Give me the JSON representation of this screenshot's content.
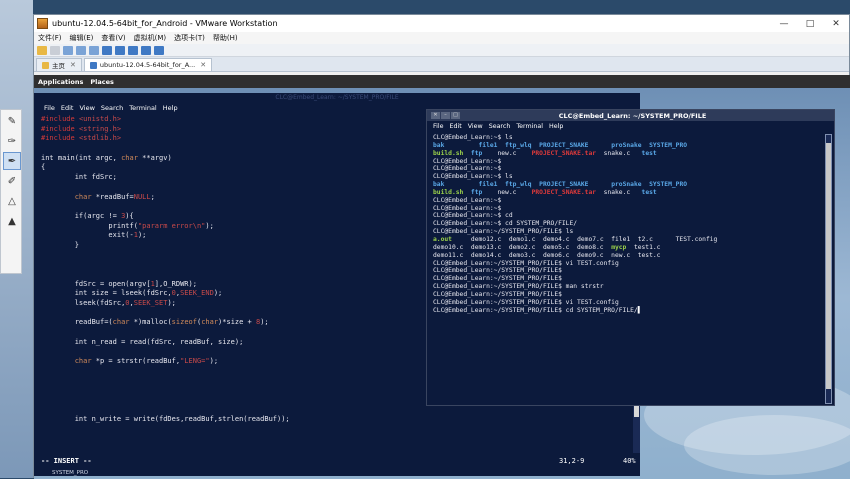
{
  "vm": {
    "title": "ubuntu-12.04.5-64bit_for_Android - VMware Workstation",
    "menu": [
      "文件(F)",
      "编辑(E)",
      "查看(V)",
      "虚拟机(M)",
      "选项卡(T)",
      "帮助(H)"
    ],
    "tabs": [
      {
        "label": "主页",
        "active": false
      },
      {
        "label": "ubuntu-12.04.5-64bit_for_A...",
        "active": true
      }
    ],
    "window_controls": [
      "—",
      "□",
      "✕"
    ]
  },
  "guest": {
    "panel": [
      "Applications",
      "Places"
    ],
    "editor": {
      "title": "CLC@Embed_Learn: ~/SYSTEM_PRO/FILE",
      "menu": [
        "File",
        "Edit",
        "View",
        "Search",
        "Terminal",
        "Help"
      ],
      "lines": [
        [
          [
            "pp",
            "#include "
          ],
          [
            "str",
            "<unistd.h>"
          ]
        ],
        [
          [
            "pp",
            "#include "
          ],
          [
            "str",
            "<string.h>"
          ]
        ],
        [
          [
            "pp",
            "#include "
          ],
          [
            "str",
            "<stdlib.h>"
          ]
        ],
        [],
        [
          [
            "kw",
            "int main(int argc, "
          ],
          [
            "typ",
            "char"
          ],
          [
            "kw",
            " **argv)"
          ]
        ],
        [
          [
            "kw",
            "{"
          ]
        ],
        [
          [
            "kw",
            "        int fdSrc;"
          ]
        ],
        [],
        [
          [
            "kw",
            "        "
          ],
          [
            "typ",
            "char"
          ],
          [
            "kw",
            " *readBuf="
          ],
          [
            "num",
            "NULL"
          ],
          [
            "kw",
            ";"
          ]
        ],
        [],
        [
          [
            "kw",
            "        if(argc != "
          ],
          [
            "num",
            "3"
          ],
          [
            "kw",
            "){"
          ]
        ],
        [
          [
            "kw",
            "                printf("
          ],
          [
            "str",
            "\"pararm error\\n\""
          ],
          [
            "kw",
            ");"
          ]
        ],
        [
          [
            "kw",
            "                exit(-"
          ],
          [
            "num",
            "1"
          ],
          [
            "kw",
            ");"
          ]
        ],
        [
          [
            "kw",
            "        }"
          ]
        ],
        [],
        [],
        [],
        [
          [
            "kw",
            "        fdSrc = open(argv["
          ],
          [
            "num",
            "1"
          ],
          [
            "kw",
            "],O_RDWR);"
          ]
        ],
        [
          [
            "kw",
            "        int size = lseek(fdSrc,"
          ],
          [
            "num",
            "0"
          ],
          [
            "kw",
            ","
          ],
          [
            "num",
            "SEEK_END"
          ],
          [
            "kw",
            ");"
          ]
        ],
        [
          [
            "kw",
            "        lseek(fdSrc,"
          ],
          [
            "num",
            "0"
          ],
          [
            "kw",
            ","
          ],
          [
            "num",
            "SEEK_SET"
          ],
          [
            "kw",
            ");"
          ]
        ],
        [],
        [
          [
            "kw",
            "        readBuf=("
          ],
          [
            "typ",
            "char"
          ],
          [
            "kw",
            " *)malloc("
          ],
          [
            "typ",
            "sizeof"
          ],
          [
            "kw",
            "("
          ],
          [
            "typ",
            "char"
          ],
          [
            "kw",
            ")*size + "
          ],
          [
            "num",
            "8"
          ],
          [
            "kw",
            ");"
          ]
        ],
        [],
        [
          [
            "kw",
            "        int n_read = read(fdSrc, readBuf, size);"
          ]
        ],
        [],
        [
          [
            "kw",
            "        "
          ],
          [
            "typ",
            "char"
          ],
          [
            "kw",
            " *p = strstr(readBuf,"
          ],
          [
            "str",
            "\"LENG=\""
          ],
          [
            "kw",
            ");"
          ]
        ],
        [],
        [],
        [],
        [],
        [],
        [
          [
            "kw",
            "        int n_write = write(fdDes,readBuf,strlen(readBuf));"
          ]
        ]
      ],
      "status_mode": "-- INSERT --",
      "status_pos": "31,2-9",
      "status_pct": "40%",
      "footer": "SYSTEM_PRO",
      "scroll_fraction": 0.4
    },
    "terminal": {
      "title": "CLC@Embed_Learn: ~/SYSTEM_PRO/FILE",
      "menu": [
        "File",
        "Edit",
        "View",
        "Search",
        "Terminal",
        "Help"
      ],
      "rows": [
        [
          [
            "w",
            "CLC@Embed_Learn:~$ ls"
          ]
        ],
        [
          [
            "c",
            "bak         "
          ],
          [
            "c",
            "file1  "
          ],
          [
            "c",
            "ftp_wlq  "
          ],
          [
            "c",
            "PROJECT_SNAKE      "
          ],
          [
            "c",
            "proSnake  "
          ],
          [
            "c",
            "SYSTEM_PRO"
          ]
        ],
        [
          [
            "g",
            "build.sh  "
          ],
          [
            "c",
            "ftp    "
          ],
          [
            "w",
            "new.c    "
          ],
          [
            "r",
            "PROJECT_SNAKE.tar  "
          ],
          [
            "w",
            "snake.c   "
          ],
          [
            "c",
            "test"
          ]
        ],
        [
          [
            "w",
            "CLC@Embed_Learn:~$"
          ]
        ],
        [
          [
            "w",
            "CLC@Embed_Learn:~$"
          ]
        ],
        [
          [
            "w",
            "CLC@Embed_Learn:~$ ls"
          ]
        ],
        [
          [
            "c",
            "bak         "
          ],
          [
            "c",
            "file1  "
          ],
          [
            "c",
            "ftp_wlq  "
          ],
          [
            "c",
            "PROJECT_SNAKE      "
          ],
          [
            "c",
            "proSnake  "
          ],
          [
            "c",
            "SYSTEM_PRO"
          ]
        ],
        [
          [
            "g",
            "build.sh  "
          ],
          [
            "c",
            "ftp    "
          ],
          [
            "w",
            "new.c    "
          ],
          [
            "r",
            "PROJECT_SNAKE.tar  "
          ],
          [
            "w",
            "snake.c   "
          ],
          [
            "c",
            "test"
          ]
        ],
        [
          [
            "w",
            "CLC@Embed_Learn:~$"
          ]
        ],
        [
          [
            "w",
            "CLC@Embed_Learn:~$"
          ]
        ],
        [
          [
            "w",
            "CLC@Embed_Learn:~$ cd"
          ]
        ],
        [
          [
            "w",
            "CLC@Embed_Learn:~$ cd SYSTEM_PRO/FILE/"
          ]
        ],
        [
          [
            "w",
            "CLC@Embed_Learn:~/SYSTEM_PRO/FILE$ ls"
          ]
        ],
        [
          [
            "g",
            "a.out     "
          ],
          [
            "w",
            "demo12.c  demo1.c  demo4.c  demo7.c  file1  t2.c      TEST.config"
          ]
        ],
        [
          [
            "w",
            "demo10.c  demo13.c  demo2.c  demo5.c  demo8.c  "
          ],
          [
            "g",
            "mycp  "
          ],
          [
            "w",
            "test1.c"
          ]
        ],
        [
          [
            "w",
            "demo11.c  demo14.c  demo3.c  demo6.c  demo9.c  new.c  test.c"
          ]
        ],
        [
          [
            "w",
            "CLC@Embed_Learn:~/SYSTEM_PRO/FILE$ vi TEST.config"
          ]
        ],
        [
          [
            "w",
            "CLC@Embed_Learn:~/SYSTEM_PRO/FILE$"
          ]
        ],
        [
          [
            "w",
            "CLC@Embed_Learn:~/SYSTEM_PRO/FILE$"
          ]
        ],
        [
          [
            "w",
            "CLC@Embed_Learn:~/SYSTEM_PRO/FILE$ man strstr"
          ]
        ],
        [
          [
            "w",
            "CLC@Embed_Learn:~/SYSTEM_PRO/FILE$"
          ]
        ],
        [
          [
            "w",
            "CLC@Embed_Learn:~/SYSTEM_PRO/FILE$ vi TEST.config"
          ]
        ],
        [
          [
            "w",
            "CLC@Embed_Learn:~/SYSTEM_PRO/FILE$ cd SYSTEM_PRO/FILE/"
          ],
          [
            "cur",
            "▌"
          ]
        ]
      ]
    }
  },
  "colors": {
    "editor_bg": "#0c1a3c",
    "preproc": "#d23a3a",
    "string": "#c94a4a",
    "type": "#d08a5a",
    "term_cyan": "#5aa8e8",
    "term_green": "#9bd14a",
    "term_red": "#e03a3a",
    "term_white": "#e8e8f0"
  },
  "icons": {
    "vm_app": "vmware-icon",
    "tab_home": "home-icon",
    "tab_vm": "vm-icon"
  }
}
